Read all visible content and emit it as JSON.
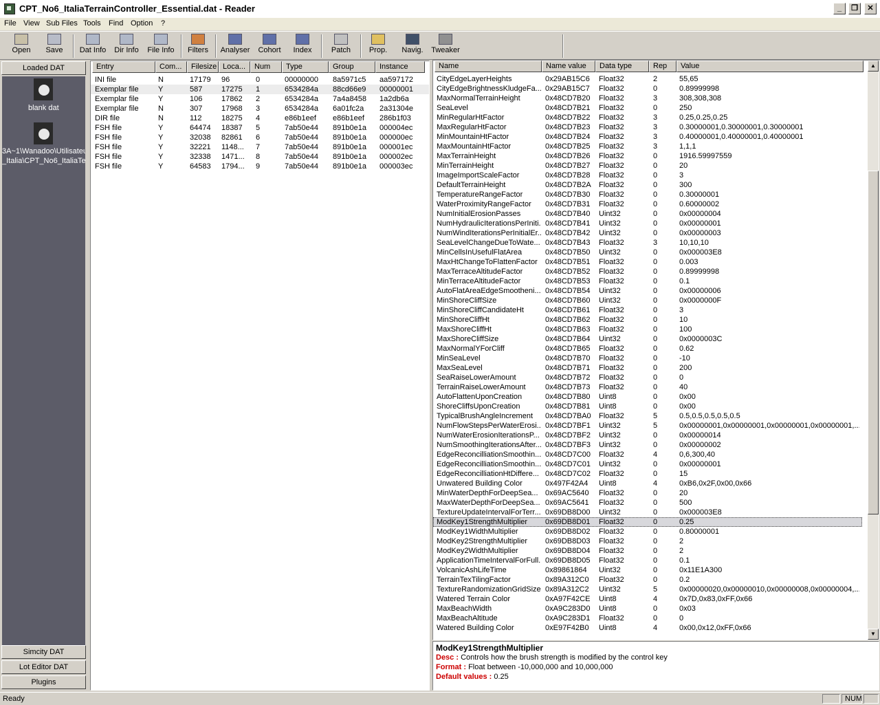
{
  "window": {
    "title": "CPT_No6_ItaliaTerrainController_Essential.dat - Reader"
  },
  "menu": [
    "File",
    "View",
    "Sub Files",
    "Tools",
    "Find",
    "Option",
    "?"
  ],
  "toolbar": [
    "Open",
    "Save",
    "Dat Info",
    "Dir Info",
    "File Info",
    "Filters",
    "Analyser",
    "Cohort",
    "Index",
    "Patch",
    "Prop.",
    "Navig.",
    "Tweaker"
  ],
  "left_panel": {
    "loaded_header": "Loaded DAT",
    "items": [
      {
        "label": "blank dat"
      },
      {
        "label_line1": "3A~1\\Wanadoo\\Utilisateu",
        "label_line2": "_Italia\\CPT_No6_ItaliaTe"
      }
    ],
    "buttons": [
      "Simcity DAT",
      "Lot Editor DAT",
      "Plugins"
    ]
  },
  "entries": {
    "columns": [
      "Entry",
      "Com...",
      "Filesize",
      "Loca...",
      "Num",
      "Type",
      "Group",
      "Instance"
    ],
    "rows": [
      [
        "INI file",
        "N",
        "17179",
        "96",
        "0",
        "00000000",
        "8a5971c5",
        "aa597172"
      ],
      [
        "Exemplar file",
        "Y",
        "587",
        "17275",
        "1",
        "6534284a",
        "88cd66e9",
        "00000001"
      ],
      [
        "Exemplar file",
        "Y",
        "106",
        "17862",
        "2",
        "6534284a",
        "7a4a8458",
        "1a2db6a"
      ],
      [
        "Exemplar file",
        "N",
        "307",
        "17968",
        "3",
        "6534284a",
        "6a01fc2a",
        "2a31304e"
      ],
      [
        "DIR file",
        "N",
        "112",
        "18275",
        "4",
        "e86b1eef",
        "e86b1eef",
        "286b1f03"
      ],
      [
        "FSH file",
        "Y",
        "64474",
        "18387",
        "5",
        "7ab50e44",
        "891b0e1a",
        "000004ec"
      ],
      [
        "FSH file",
        "Y",
        "32038",
        "82861",
        "6",
        "7ab50e44",
        "891b0e1a",
        "000000ec"
      ],
      [
        "FSH file",
        "Y",
        "32221",
        "1148...",
        "7",
        "7ab50e44",
        "891b0e1a",
        "000001ec"
      ],
      [
        "FSH file",
        "Y",
        "32338",
        "1471...",
        "8",
        "7ab50e44",
        "891b0e1a",
        "000002ec"
      ],
      [
        "FSH file",
        "Y",
        "64583",
        "1794...",
        "9",
        "7ab50e44",
        "891b0e1a",
        "000003ec"
      ]
    ]
  },
  "properties": {
    "columns": [
      "Name",
      "Name value",
      "Data type",
      "Rep",
      "Value"
    ],
    "rows": [
      [
        "CityEdgeLayerHeights",
        "0x29AB15C6",
        "Float32",
        "2",
        "55,65"
      ],
      [
        "CityEdgeBrightnessKludgeFa...",
        "0x29AB15C7",
        "Float32",
        "0",
        "0.89999998"
      ],
      [
        "MaxNormalTerrainHeight",
        "0x48CD7B20",
        "Float32",
        "3",
        "308,308,308"
      ],
      [
        "SeaLevel",
        "0x48CD7B21",
        "Float32",
        "0",
        "250"
      ],
      [
        "MinRegularHtFactor",
        "0x48CD7B22",
        "Float32",
        "3",
        "0.25,0.25,0.25"
      ],
      [
        "MaxRegularHtFactor",
        "0x48CD7B23",
        "Float32",
        "3",
        "0.30000001,0.30000001,0.30000001"
      ],
      [
        "MinMountainHtFactor",
        "0x48CD7B24",
        "Float32",
        "3",
        "0.40000001,0.40000001,0.40000001"
      ],
      [
        "MaxMountainHtFactor",
        "0x48CD7B25",
        "Float32",
        "3",
        "1,1,1"
      ],
      [
        "MaxTerrainHeight",
        "0x48CD7B26",
        "Float32",
        "0",
        "1916.59997559"
      ],
      [
        "MinTerrainHeight",
        "0x48CD7B27",
        "Float32",
        "0",
        "20"
      ],
      [
        "ImageImportScaleFactor",
        "0x48CD7B28",
        "Float32",
        "0",
        "3"
      ],
      [
        "DefaultTerrainHeight",
        "0x48CD7B2A",
        "Float32",
        "0",
        "300"
      ],
      [
        "TemperatureRangeFactor",
        "0x48CD7B30",
        "Float32",
        "0",
        "0.30000001"
      ],
      [
        "WaterProximityRangeFactor",
        "0x48CD7B31",
        "Float32",
        "0",
        "0.60000002"
      ],
      [
        "NumInitialErosionPasses",
        "0x48CD7B40",
        "Uint32",
        "0",
        "0x00000004"
      ],
      [
        "NumHydraulicIterationsPerIniti...",
        "0x48CD7B41",
        "Uint32",
        "0",
        "0x00000001"
      ],
      [
        "NumWindIterationsPerInitialEr...",
        "0x48CD7B42",
        "Uint32",
        "0",
        "0x00000003"
      ],
      [
        "SeaLevelChangeDueToWate...",
        "0x48CD7B43",
        "Float32",
        "3",
        "10,10,10"
      ],
      [
        "MinCellsInUsefulFlatArea",
        "0x48CD7B50",
        "Uint32",
        "0",
        "0x000003E8"
      ],
      [
        "MaxHtChangeToFlattenFactor",
        "0x48CD7B51",
        "Float32",
        "0",
        "0.003"
      ],
      [
        "MaxTerraceAltitudeFactor",
        "0x48CD7B52",
        "Float32",
        "0",
        "0.89999998"
      ],
      [
        "MinTerraceAltitudeFactor",
        "0x48CD7B53",
        "Float32",
        "0",
        "0.1"
      ],
      [
        "AutoFlatAreaEdgeSmootheni...",
        "0x48CD7B54",
        "Uint32",
        "0",
        "0x00000006"
      ],
      [
        "MinShoreCliffSize",
        "0x48CD7B60",
        "Uint32",
        "0",
        "0x0000000F"
      ],
      [
        "MinShoreCliffCandidateHt",
        "0x48CD7B61",
        "Float32",
        "0",
        "3"
      ],
      [
        "MinShoreCliffHt",
        "0x48CD7B62",
        "Float32",
        "0",
        "10"
      ],
      [
        "MaxShoreCliffHt",
        "0x48CD7B63",
        "Float32",
        "0",
        "100"
      ],
      [
        "MaxShoreCliffSize",
        "0x48CD7B64",
        "Uint32",
        "0",
        "0x0000003C"
      ],
      [
        "MaxNormalYForCliff",
        "0x48CD7B65",
        "Float32",
        "0",
        "0.62"
      ],
      [
        "MinSeaLevel",
        "0x48CD7B70",
        "Float32",
        "0",
        "-10"
      ],
      [
        "MaxSeaLevel",
        "0x48CD7B71",
        "Float32",
        "0",
        "200"
      ],
      [
        "SeaRaiseLowerAmount",
        "0x48CD7B72",
        "Float32",
        "0",
        "0"
      ],
      [
        "TerrainRaiseLowerAmount",
        "0x48CD7B73",
        "Float32",
        "0",
        "40"
      ],
      [
        "AutoFlattenUponCreation",
        "0x48CD7B80",
        "Uint8",
        "0",
        "0x00"
      ],
      [
        "ShoreCliffsUponCreation",
        "0x48CD7B81",
        "Uint8",
        "0",
        "0x00"
      ],
      [
        "TypicalBrushAngleIncrement",
        "0x48CD7BA0",
        "Float32",
        "5",
        "0.5,0.5,0.5,0.5,0.5"
      ],
      [
        "NumFlowStepsPerWaterErosi...",
        "0x48CD7BF1",
        "Uint32",
        "5",
        "0x00000001,0x00000001,0x00000001,0x00000001,..."
      ],
      [
        "NumWaterErosionIterationsP...",
        "0x48CD7BF2",
        "Uint32",
        "0",
        "0x00000014"
      ],
      [
        "NumSmoothingIterationsAfter...",
        "0x48CD7BF3",
        "Uint32",
        "0",
        "0x00000002"
      ],
      [
        "EdgeReconcilliationSmoothin...",
        "0x48CD7C00",
        "Float32",
        "4",
        "0,6,300,40"
      ],
      [
        "EdgeReconcilliationSmoothin...",
        "0x48CD7C01",
        "Uint32",
        "0",
        "0x00000001"
      ],
      [
        "EdgeReconcilliationHtDiffere...",
        "0x48CD7C02",
        "Float32",
        "0",
        "15"
      ],
      [
        "Unwatered Building Color",
        "0x497F42A4",
        "Uint8",
        "4",
        "0xB6,0x2F,0x00,0x66"
      ],
      [
        "MinWaterDepthForDeepSea...",
        "0x69AC5640",
        "Float32",
        "0",
        "20"
      ],
      [
        "MaxWaterDepthForDeepSea...",
        "0x69AC5641",
        "Float32",
        "0",
        "500"
      ],
      [
        "TextureUpdateIntervalForTerr...",
        "0x69DB8D00",
        "Uint32",
        "0",
        "0x000003E8"
      ],
      [
        "ModKey1StrengthMultiplier",
        "0x69DB8D01",
        "Float32",
        "0",
        "0.25"
      ],
      [
        "ModKey1WidthMultiplier",
        "0x69DB8D02",
        "Float32",
        "0",
        "0.80000001"
      ],
      [
        "ModKey2StrengthMultiplier",
        "0x69DB8D03",
        "Float32",
        "0",
        "2"
      ],
      [
        "ModKey2WidthMultiplier",
        "0x69DB8D04",
        "Float32",
        "0",
        "2"
      ],
      [
        "ApplicationTimeIntervalForFull...",
        "0x69DB8D05",
        "Float32",
        "0",
        "0.1"
      ],
      [
        "VolcanicAshLifeTime",
        "0x89861864",
        "Uint32",
        "0",
        "0x11E1A300"
      ],
      [
        "TerrainTexTilingFactor",
        "0x89A312C0",
        "Float32",
        "0",
        "0.2"
      ],
      [
        "TextureRandomizationGridSize",
        "0x89A312C2",
        "Uint32",
        "5",
        "0x00000020,0x00000010,0x00000008,0x00000004,..."
      ],
      [
        "Watered Terrain Color",
        "0xA97F42CE",
        "Uint8",
        "4",
        "0x7D,0x83,0xFF,0x66"
      ],
      [
        "MaxBeachWidth",
        "0xA9C283D0",
        "Uint8",
        "0",
        "0x03"
      ],
      [
        "MaxBeachAltitude",
        "0xA9C283D1",
        "Float32",
        "0",
        "0"
      ],
      [
        "Watered Building Color",
        "0xE97F42B0",
        "Uint8",
        "4",
        "0x00,0x12,0xFF,0x66"
      ]
    ]
  },
  "description": {
    "title": "ModKey1StrengthMultiplier",
    "desc_label": "Desc :",
    "desc": "Controls how the brush strength is modified by the control key",
    "format_label": "Format :",
    "format": "Float between -10,000,000 and 10,000,000",
    "default_label": "Default values :",
    "default": "0.25"
  },
  "status": {
    "text": "Ready",
    "num": "NUM"
  }
}
